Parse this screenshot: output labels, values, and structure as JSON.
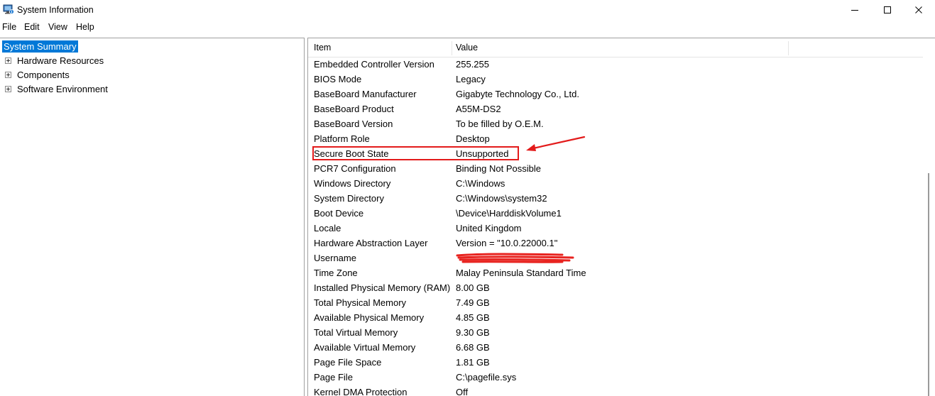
{
  "window": {
    "title": "System Information"
  },
  "menu": [
    "File",
    "Edit",
    "View",
    "Help"
  ],
  "tree": {
    "selected": "System Summary",
    "items": [
      "Hardware Resources",
      "Components",
      "Software Environment"
    ]
  },
  "table": {
    "columns": [
      "Item",
      "Value"
    ],
    "rows": [
      {
        "item": "Embedded Controller Version",
        "value": "255.255"
      },
      {
        "item": "BIOS Mode",
        "value": "Legacy"
      },
      {
        "item": "BaseBoard Manufacturer",
        "value": "Gigabyte Technology Co., Ltd."
      },
      {
        "item": "BaseBoard Product",
        "value": "A55M-DS2"
      },
      {
        "item": "BaseBoard Version",
        "value": "To be filled by O.E.M."
      },
      {
        "item": "Platform Role",
        "value": "Desktop"
      },
      {
        "item": "Secure Boot State",
        "value": "Unsupported"
      },
      {
        "item": "PCR7 Configuration",
        "value": "Binding Not Possible"
      },
      {
        "item": "Windows Directory",
        "value": "C:\\Windows"
      },
      {
        "item": "System Directory",
        "value": "C:\\Windows\\system32"
      },
      {
        "item": "Boot Device",
        "value": "\\Device\\HarddiskVolume1"
      },
      {
        "item": "Locale",
        "value": "United Kingdom"
      },
      {
        "item": "Hardware Abstraction Layer",
        "value": "Version = \"10.0.22000.1\""
      },
      {
        "item": "Username",
        "value": ""
      },
      {
        "item": "Time Zone",
        "value": "Malay Peninsula Standard Time"
      },
      {
        "item": "Installed Physical Memory (RAM)",
        "value": "8.00 GB"
      },
      {
        "item": "Total Physical Memory",
        "value": "7.49 GB"
      },
      {
        "item": "Available Physical Memory",
        "value": "4.85 GB"
      },
      {
        "item": "Total Virtual Memory",
        "value": "9.30 GB"
      },
      {
        "item": "Available Virtual Memory",
        "value": "6.68 GB"
      },
      {
        "item": "Page File Space",
        "value": "1.81 GB"
      },
      {
        "item": "Page File",
        "value": "C:\\pagefile.sys"
      },
      {
        "item": "Kernel DMA Protection",
        "value": "Off"
      }
    ]
  },
  "colors": {
    "selection": "#0078d7",
    "annotation": "#e31b1b"
  },
  "icons": {
    "app": "system-information-icon",
    "minimize": "minimize-icon",
    "maximize": "maximize-icon",
    "close": "close-icon",
    "expander": "plus-expander-icon"
  }
}
